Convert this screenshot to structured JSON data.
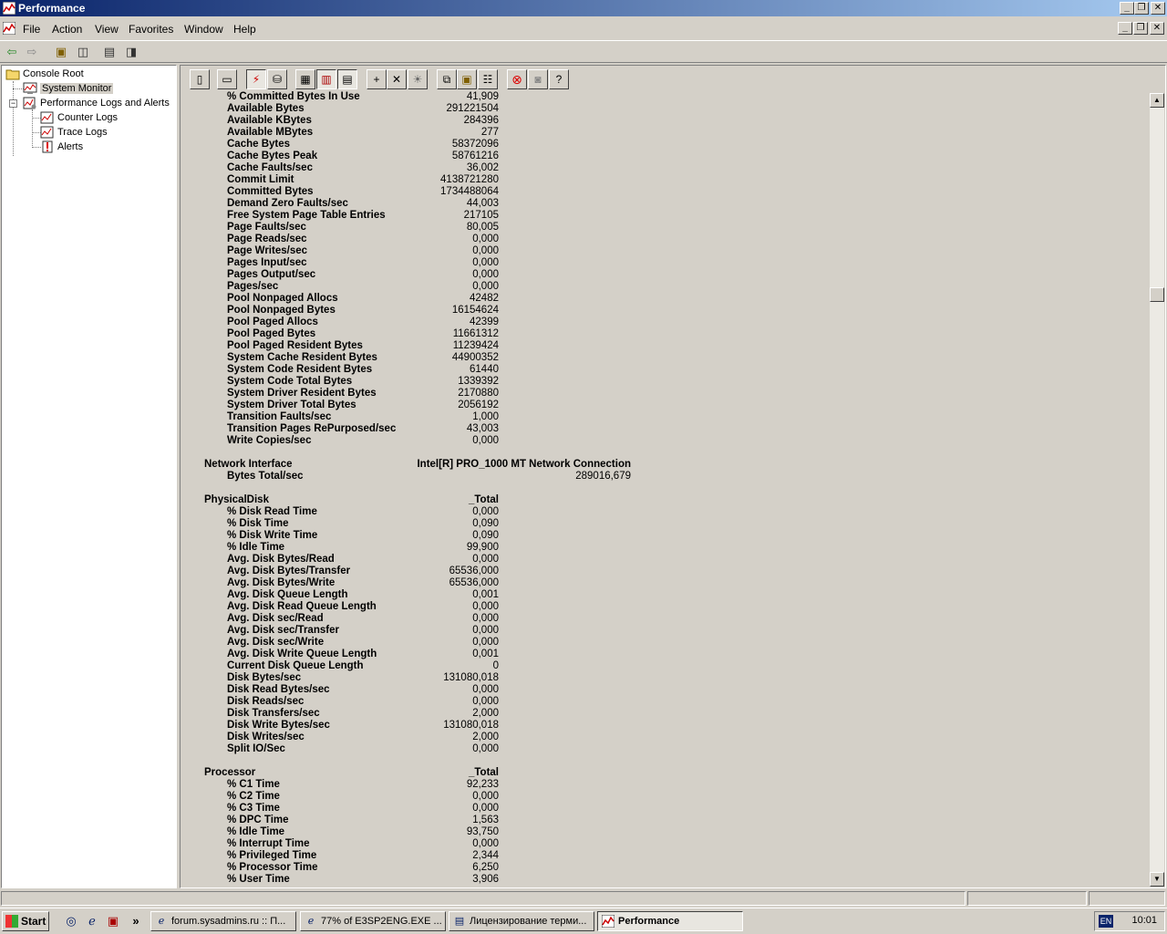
{
  "window": {
    "title": "Performance",
    "title_icon": "performance-icon"
  },
  "menu": [
    "File",
    "Action",
    "View",
    "Favorites",
    "Window",
    "Help"
  ],
  "tree": {
    "root": "Console Root",
    "system_monitor": "System Monitor",
    "perf_logs": "Performance Logs and Alerts",
    "counter_logs": "Counter Logs",
    "trace_logs": "Trace Logs",
    "alerts": "Alerts"
  },
  "report": {
    "memory_counters": [
      {
        "name": "% Committed Bytes In Use",
        "value": "41,909"
      },
      {
        "name": "Available Bytes",
        "value": "291221504"
      },
      {
        "name": "Available KBytes",
        "value": "284396"
      },
      {
        "name": "Available MBytes",
        "value": "277"
      },
      {
        "name": "Cache Bytes",
        "value": "58372096"
      },
      {
        "name": "Cache Bytes Peak",
        "value": "58761216"
      },
      {
        "name": "Cache Faults/sec",
        "value": "36,002"
      },
      {
        "name": "Commit Limit",
        "value": "4138721280"
      },
      {
        "name": "Committed Bytes",
        "value": "1734488064"
      },
      {
        "name": "Demand Zero Faults/sec",
        "value": "44,003"
      },
      {
        "name": "Free System Page Table Entries",
        "value": "217105"
      },
      {
        "name": "Page Faults/sec",
        "value": "80,005"
      },
      {
        "name": "Page Reads/sec",
        "value": "0,000"
      },
      {
        "name": "Page Writes/sec",
        "value": "0,000"
      },
      {
        "name": "Pages Input/sec",
        "value": "0,000"
      },
      {
        "name": "Pages Output/sec",
        "value": "0,000"
      },
      {
        "name": "Pages/sec",
        "value": "0,000"
      },
      {
        "name": "Pool Nonpaged Allocs",
        "value": "42482"
      },
      {
        "name": "Pool Nonpaged Bytes",
        "value": "16154624"
      },
      {
        "name": "Pool Paged Allocs",
        "value": "42399"
      },
      {
        "name": "Pool Paged Bytes",
        "value": "11661312"
      },
      {
        "name": "Pool Paged Resident Bytes",
        "value": "11239424"
      },
      {
        "name": "System Cache Resident Bytes",
        "value": "44900352"
      },
      {
        "name": "System Code Resident Bytes",
        "value": "61440"
      },
      {
        "name": "System Code Total Bytes",
        "value": "1339392"
      },
      {
        "name": "System Driver Resident Bytes",
        "value": "2170880"
      },
      {
        "name": "System Driver Total Bytes",
        "value": "2056192"
      },
      {
        "name": "Transition Faults/sec",
        "value": "1,000"
      },
      {
        "name": "Transition Pages RePurposed/sec",
        "value": "43,003"
      },
      {
        "name": "Write Copies/sec",
        "value": "0,000"
      }
    ],
    "network": {
      "object": "Network Interface",
      "instance": "Intel[R] PRO_1000 MT Network Connection",
      "counters": [
        {
          "name": "Bytes Total/sec",
          "value": "289016,679"
        }
      ]
    },
    "disk": {
      "object": "PhysicalDisk",
      "instance": "_Total",
      "counters": [
        {
          "name": "% Disk Read Time",
          "value": "0,000"
        },
        {
          "name": "% Disk Time",
          "value": "0,090"
        },
        {
          "name": "% Disk Write Time",
          "value": "0,090"
        },
        {
          "name": "% Idle Time",
          "value": "99,900"
        },
        {
          "name": "Avg. Disk Bytes/Read",
          "value": "0,000"
        },
        {
          "name": "Avg. Disk Bytes/Transfer",
          "value": "65536,000"
        },
        {
          "name": "Avg. Disk Bytes/Write",
          "value": "65536,000"
        },
        {
          "name": "Avg. Disk Queue Length",
          "value": "0,001"
        },
        {
          "name": "Avg. Disk Read Queue Length",
          "value": "0,000"
        },
        {
          "name": "Avg. Disk sec/Read",
          "value": "0,000"
        },
        {
          "name": "Avg. Disk sec/Transfer",
          "value": "0,000"
        },
        {
          "name": "Avg. Disk sec/Write",
          "value": "0,000"
        },
        {
          "name": "Avg. Disk Write Queue Length",
          "value": "0,001"
        },
        {
          "name": "Current Disk Queue Length",
          "value": "0"
        },
        {
          "name": "Disk Bytes/sec",
          "value": "131080,018"
        },
        {
          "name": "Disk Read Bytes/sec",
          "value": "0,000"
        },
        {
          "name": "Disk Reads/sec",
          "value": "0,000"
        },
        {
          "name": "Disk Transfers/sec",
          "value": "2,000"
        },
        {
          "name": "Disk Write Bytes/sec",
          "value": "131080,018"
        },
        {
          "name": "Disk Writes/sec",
          "value": "2,000"
        },
        {
          "name": "Split IO/Sec",
          "value": "0,000"
        }
      ]
    },
    "processor": {
      "object": "Processor",
      "instance": "_Total",
      "counters": [
        {
          "name": "% C1 Time",
          "value": "92,233"
        },
        {
          "name": "% C2 Time",
          "value": "0,000"
        },
        {
          "name": "% C3 Time",
          "value": "0,000"
        },
        {
          "name": "% DPC Time",
          "value": "1,563"
        },
        {
          "name": "% Idle Time",
          "value": "93,750"
        },
        {
          "name": "% Interrupt Time",
          "value": "0,000"
        },
        {
          "name": "% Privileged Time",
          "value": "2,344"
        },
        {
          "name": "% Processor Time",
          "value": "6,250"
        },
        {
          "name": "% User Time",
          "value": "3,906"
        }
      ]
    }
  },
  "taskbar": {
    "start": "Start",
    "tasks": [
      {
        "label": "forum.sysadmins.ru :: П...",
        "icon": "ie-icon"
      },
      {
        "label": "77% of E3SP2ENG.EXE ...",
        "icon": "ie-icon"
      },
      {
        "label": "Лицензирование терми...",
        "icon": "doc-icon"
      },
      {
        "label": "Performance",
        "icon": "performance-icon",
        "active": true
      }
    ],
    "lang": "EN",
    "clock": "10:01"
  }
}
